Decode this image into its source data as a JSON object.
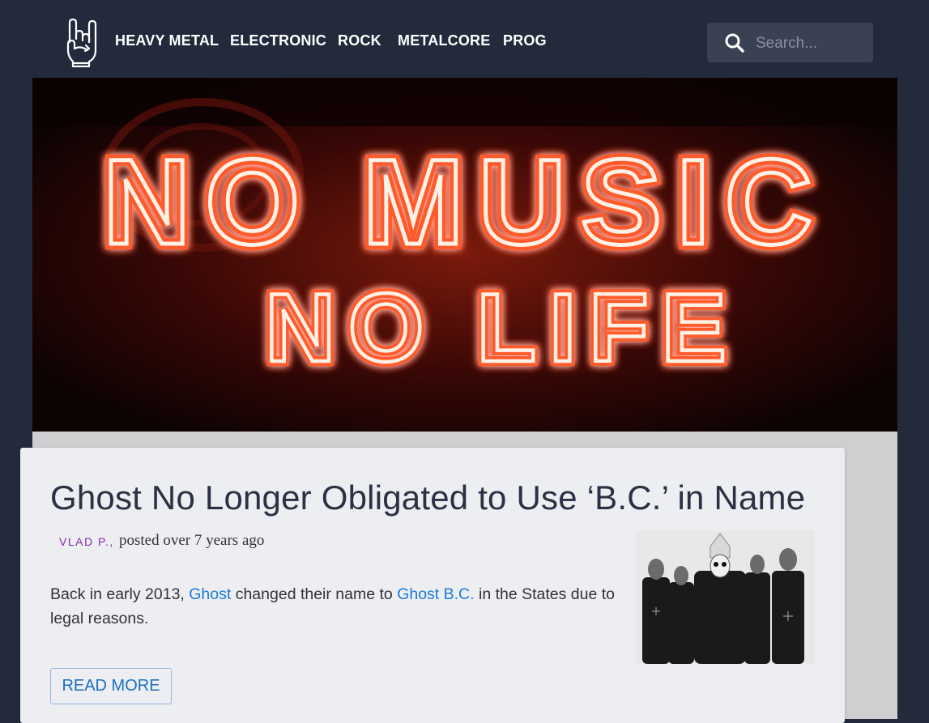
{
  "nav": {
    "items": [
      "HEAVY METAL",
      "ELECTRONIC",
      "ROCK",
      "METALCORE",
      "PROG"
    ]
  },
  "search": {
    "placeholder": "Search..."
  },
  "hero": {
    "sign_line1": "NO MUSIC",
    "sign_line2": "NO LIFE"
  },
  "article": {
    "title": "Ghost No Longer Obligated to Use ‘B.C.’ in Name",
    "author": "VLAD P.,",
    "posted": "posted over 7 years ago",
    "excerpt": {
      "part1": "Back in early 2013, ",
      "link1": "Ghost",
      "part2": " changed their name to ",
      "link2": "Ghost B.C.",
      "part3": " in the States due to legal reasons."
    },
    "read_more": "READ MORE"
  },
  "colors": {
    "header_bg": "#232a3c",
    "link": "#1e7ad6",
    "author": "#8a2aa8",
    "neon": "#ff6a3a"
  },
  "icons": {
    "logo": "rock-hand-icon",
    "search": "search-icon"
  }
}
